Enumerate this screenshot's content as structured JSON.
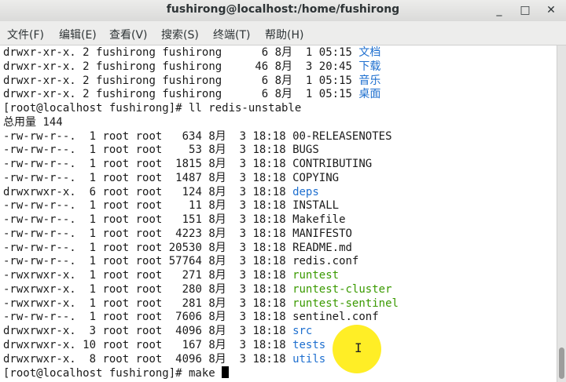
{
  "window": {
    "title": "fushirong@localhost:/home/fushirong",
    "minimize_glyph": "_",
    "maximize_glyph": "□",
    "close_glyph": "✕"
  },
  "menu": {
    "items": [
      "文件(F)",
      "编辑(E)",
      "查看(V)",
      "搜索(S)",
      "终端(T)",
      "帮助(H)"
    ]
  },
  "terminal": {
    "lines": [
      {
        "perm": "drwxr-xr-x.",
        "links": "2",
        "owner": "fushirong",
        "group": "fushirong",
        "size": "6",
        "month": "8月",
        "day": "1",
        "time": "05:15",
        "name": "文档",
        "color": "blue"
      },
      {
        "perm": "drwxr-xr-x.",
        "links": "2",
        "owner": "fushirong",
        "group": "fushirong",
        "size": "46",
        "month": "8月",
        "day": "3",
        "time": "20:45",
        "name": "下载",
        "color": "blue"
      },
      {
        "perm": "drwxr-xr-x.",
        "links": "2",
        "owner": "fushirong",
        "group": "fushirong",
        "size": "6",
        "month": "8月",
        "day": "1",
        "time": "05:15",
        "name": "音乐",
        "color": "blue"
      },
      {
        "perm": "drwxr-xr-x.",
        "links": "2",
        "owner": "fushirong",
        "group": "fushirong",
        "size": "6",
        "month": "8月",
        "day": "1",
        "time": "05:15",
        "name": "桌面",
        "color": "blue"
      }
    ],
    "prompt1": "[root@localhost fushirong]# ll redis-unstable",
    "total": "总用量 144",
    "files": [
      {
        "perm": "-rw-rw-r--.",
        "links": "1",
        "owner": "root",
        "group": "root",
        "size": "634",
        "month": "8月",
        "day": "3",
        "time": "18:18",
        "name": "00-RELEASENOTES",
        "color": "plain"
      },
      {
        "perm": "-rw-rw-r--.",
        "links": "1",
        "owner": "root",
        "group": "root",
        "size": "53",
        "month": "8月",
        "day": "3",
        "time": "18:18",
        "name": "BUGS",
        "color": "plain"
      },
      {
        "perm": "-rw-rw-r--.",
        "links": "1",
        "owner": "root",
        "group": "root",
        "size": "1815",
        "month": "8月",
        "day": "3",
        "time": "18:18",
        "name": "CONTRIBUTING",
        "color": "plain"
      },
      {
        "perm": "-rw-rw-r--.",
        "links": "1",
        "owner": "root",
        "group": "root",
        "size": "1487",
        "month": "8月",
        "day": "3",
        "time": "18:18",
        "name": "COPYING",
        "color": "plain"
      },
      {
        "perm": "drwxrwxr-x.",
        "links": "6",
        "owner": "root",
        "group": "root",
        "size": "124",
        "month": "8月",
        "day": "3",
        "time": "18:18",
        "name": "deps",
        "color": "blue"
      },
      {
        "perm": "-rw-rw-r--.",
        "links": "1",
        "owner": "root",
        "group": "root",
        "size": "11",
        "month": "8月",
        "day": "3",
        "time": "18:18",
        "name": "INSTALL",
        "color": "plain"
      },
      {
        "perm": "-rw-rw-r--.",
        "links": "1",
        "owner": "root",
        "group": "root",
        "size": "151",
        "month": "8月",
        "day": "3",
        "time": "18:18",
        "name": "Makefile",
        "color": "plain"
      },
      {
        "perm": "-rw-rw-r--.",
        "links": "1",
        "owner": "root",
        "group": "root",
        "size": "4223",
        "month": "8月",
        "day": "3",
        "time": "18:18",
        "name": "MANIFESTO",
        "color": "plain"
      },
      {
        "perm": "-rw-rw-r--.",
        "links": "1",
        "owner": "root",
        "group": "root",
        "size": "20530",
        "month": "8月",
        "day": "3",
        "time": "18:18",
        "name": "README.md",
        "color": "plain"
      },
      {
        "perm": "-rw-rw-r--.",
        "links": "1",
        "owner": "root",
        "group": "root",
        "size": "57764",
        "month": "8月",
        "day": "3",
        "time": "18:18",
        "name": "redis.conf",
        "color": "plain"
      },
      {
        "perm": "-rwxrwxr-x.",
        "links": "1",
        "owner": "root",
        "group": "root",
        "size": "271",
        "month": "8月",
        "day": "3",
        "time": "18:18",
        "name": "runtest",
        "color": "green"
      },
      {
        "perm": "-rwxrwxr-x.",
        "links": "1",
        "owner": "root",
        "group": "root",
        "size": "280",
        "month": "8月",
        "day": "3",
        "time": "18:18",
        "name": "runtest-cluster",
        "color": "green"
      },
      {
        "perm": "-rwxrwxr-x.",
        "links": "1",
        "owner": "root",
        "group": "root",
        "size": "281",
        "month": "8月",
        "day": "3",
        "time": "18:18",
        "name": "runtest-sentinel",
        "color": "green"
      },
      {
        "perm": "-rw-rw-r--.",
        "links": "1",
        "owner": "root",
        "group": "root",
        "size": "7606",
        "month": "8月",
        "day": "3",
        "time": "18:18",
        "name": "sentinel.conf",
        "color": "plain"
      },
      {
        "perm": "drwxrwxr-x.",
        "links": "3",
        "owner": "root",
        "group": "root",
        "size": "4096",
        "month": "8月",
        "day": "3",
        "time": "18:18",
        "name": "src",
        "color": "blue"
      },
      {
        "perm": "drwxrwxr-x.",
        "links": "10",
        "owner": "root",
        "group": "root",
        "size": "167",
        "month": "8月",
        "day": "3",
        "time": "18:18",
        "name": "tests",
        "color": "blue"
      },
      {
        "perm": "drwxrwxr-x.",
        "links": "8",
        "owner": "root",
        "group": "root",
        "size": "4096",
        "month": "8月",
        "day": "3",
        "time": "18:18",
        "name": "utils",
        "color": "blue"
      }
    ],
    "prompt2": "[root@localhost fushirong]# make "
  },
  "colors": {
    "dir_blue": "#1e6fcf",
    "exec_green": "#3a9a00",
    "cursor_highlight": "#ffeb00"
  }
}
